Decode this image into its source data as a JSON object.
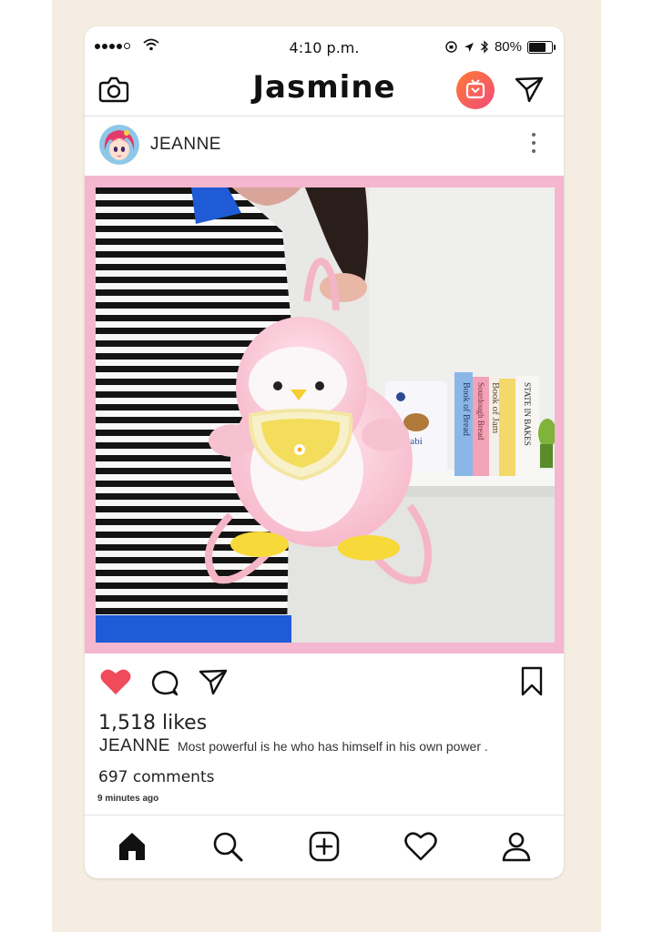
{
  "status_bar": {
    "time": "4:10 p.m.",
    "battery": "80%"
  },
  "header": {
    "title": "Jasmine"
  },
  "post": {
    "username": "JEANNE",
    "likes": "1,518 likes",
    "caption_user": "JEANNE",
    "caption_text": "Most powerful is he who has himself in his own power .",
    "comments": "697 comments",
    "time_ago": "9 minutes ago",
    "liked": true,
    "photo": {
      "books": [
        "Book of Bread",
        "Sourdough Bread",
        "Book of Jam",
        "",
        "STATE IN BAKES"
      ],
      "bag_label": "Babi"
    }
  },
  "colors": {
    "frame_pink": "#f4b7cf",
    "heart_red": "#ef4b5b",
    "igtv_gradient": [
      "#ff7a33",
      "#f14b7b"
    ]
  },
  "icons": [
    "camera-icon",
    "igtv-icon",
    "send-icon",
    "more-icon",
    "heart-icon",
    "comment-icon",
    "share-icon",
    "bookmark-icon",
    "home-icon",
    "search-icon",
    "add-icon",
    "activity-icon",
    "profile-icon"
  ]
}
